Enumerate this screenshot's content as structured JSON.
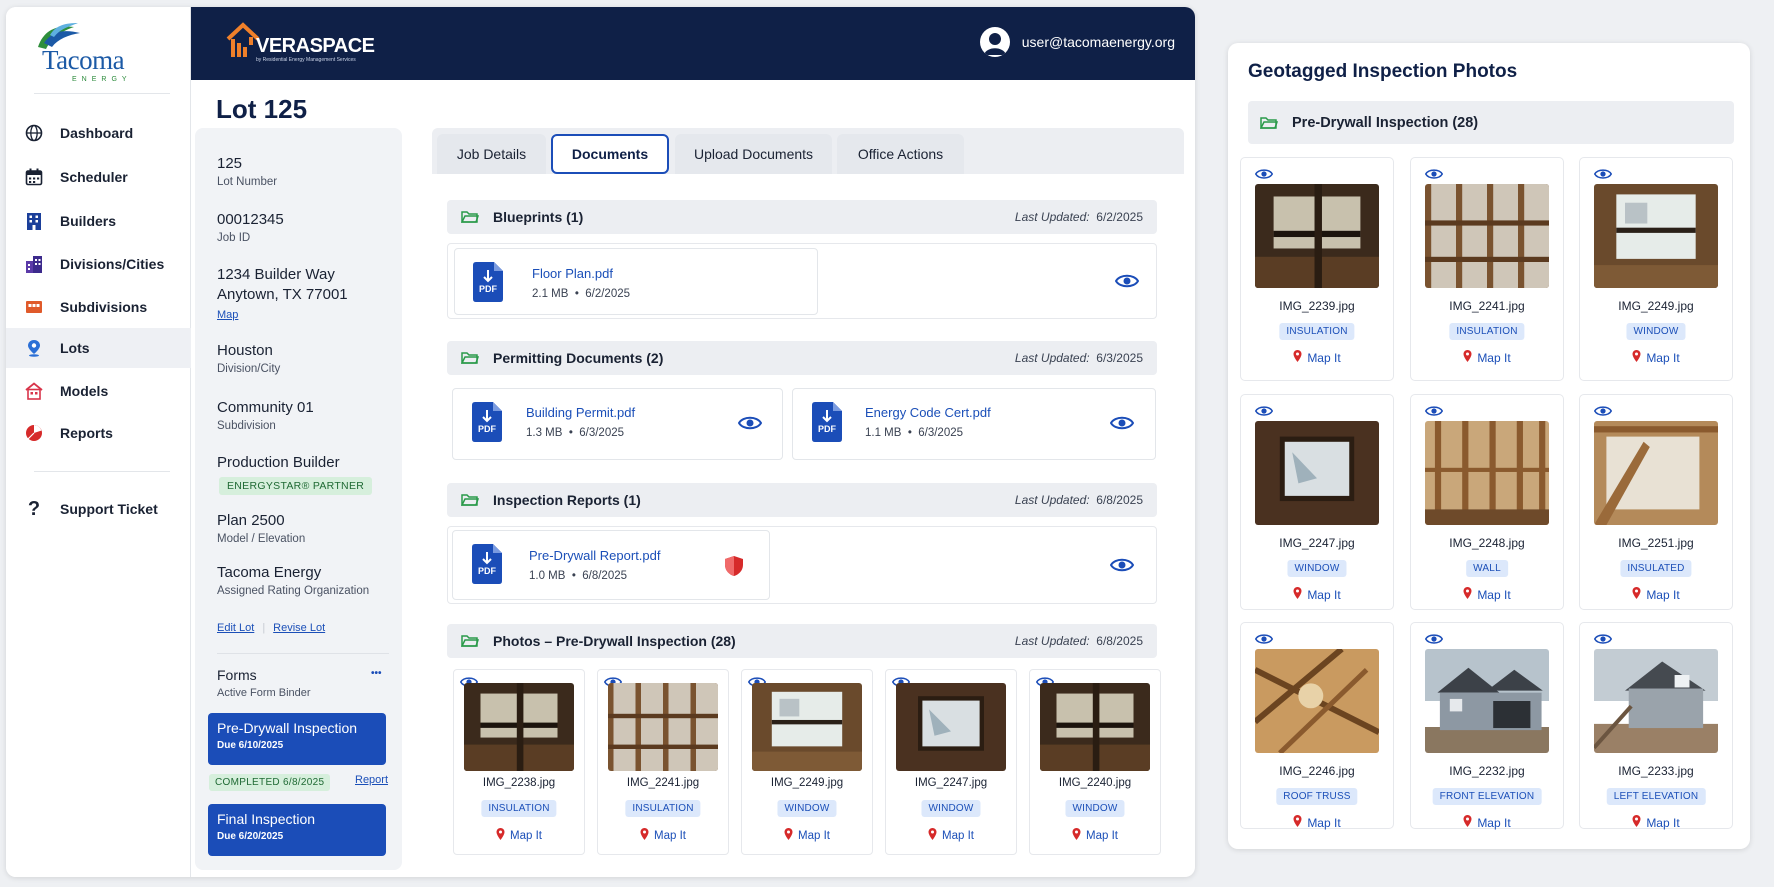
{
  "sidebar": {
    "logo_text": "Tacoma",
    "logo_sub": "ENERGY",
    "items": [
      {
        "label": "Dashboard",
        "icon": "globe-icon"
      },
      {
        "label": "Scheduler",
        "icon": "calendar-icon"
      },
      {
        "label": "Builders",
        "icon": "building-icon"
      },
      {
        "label": "Divisions/Cities",
        "icon": "city-icon"
      },
      {
        "label": "Subdivisions",
        "icon": "subdivision-icon"
      },
      {
        "label": "Lots",
        "icon": "pin-icon"
      },
      {
        "label": "Models",
        "icon": "house-icon"
      },
      {
        "label": "Reports",
        "icon": "pie-chart-icon"
      }
    ],
    "support": {
      "label": "Support Ticket",
      "icon": "question-icon"
    }
  },
  "header": {
    "brand": "VERASPACE",
    "brand_tag": "by Residential Energy Management Services",
    "user_email": "user@tacomaenergy.org"
  },
  "page": {
    "title": "Lot 125"
  },
  "lot_info": {
    "lot_number": {
      "value": "125",
      "label": "Lot Number"
    },
    "job_id": {
      "value": "00012345",
      "label": "Job ID"
    },
    "address": {
      "line1": "1234 Builder Way",
      "line2": "Anytown, TX 77001",
      "map_link": "Map"
    },
    "division": {
      "value": "Houston",
      "label": "Division/City"
    },
    "subdivision": {
      "value": "Community 01",
      "label": "Subdivision"
    },
    "builder": {
      "value": "Production Builder",
      "badge": "ENERGYSTAR® PARTNER"
    },
    "model": {
      "value": "Plan 2500",
      "label": "Model / Elevation"
    },
    "rating_org": {
      "value": "Tacoma Energy",
      "label": "Assigned Rating Organization"
    },
    "edit_link": "Edit Lot",
    "revise_link": "Revise Lot",
    "forms": {
      "title": "Forms",
      "subtitle": "Active Form Binder",
      "more": "•••",
      "items": [
        {
          "title": "Pre-Drywall Inspection",
          "due": "Due 6/10/2025",
          "status": "COMPLETED 6/8/2025",
          "report_link": "Report"
        },
        {
          "title": "Final Inspection",
          "due": "Due 6/20/2025"
        }
      ]
    }
  },
  "tabs": [
    {
      "label": "Job Details",
      "active": false
    },
    {
      "label": "Documents",
      "active": true
    },
    {
      "label": "Upload Documents",
      "active": false
    },
    {
      "label": "Office Actions",
      "active": false
    }
  ],
  "documents": {
    "updated_prefix": "Last Updated:",
    "pdf_label": "PDF",
    "sections": [
      {
        "title": "Blueprints (1)",
        "updated": "6/2/2025",
        "files": [
          {
            "name": "Floor Plan.pdf",
            "size": "2.1 MB",
            "date": "6/2/2025"
          }
        ]
      },
      {
        "title": "Permitting Documents (2)",
        "updated": "6/3/2025",
        "files": [
          {
            "name": "Building Permit.pdf",
            "size": "1.3 MB",
            "date": "6/3/2025"
          },
          {
            "name": "Energy Code Cert.pdf",
            "size": "1.1 MB",
            "date": "6/3/2025"
          }
        ]
      },
      {
        "title": "Inspection Reports (1)",
        "updated": "6/8/2025",
        "files": [
          {
            "name": "Pre-Drywall Report.pdf",
            "size": "1.0 MB",
            "date": "6/8/2025"
          }
        ]
      },
      {
        "title": "Photos – Pre-Drywall Inspection (28)",
        "updated": "6/8/2025"
      }
    ],
    "photos": [
      {
        "name": "IMG_2238.jpg",
        "tag": "INSULATION",
        "map": "Map It",
        "kind": "window-dark"
      },
      {
        "name": "IMG_2241.jpg",
        "tag": "INSULATION",
        "map": "Map It",
        "kind": "insulation"
      },
      {
        "name": "IMG_2249.jpg",
        "tag": "WINDOW",
        "map": "Map It",
        "kind": "window-light"
      },
      {
        "name": "IMG_2247.jpg",
        "tag": "WINDOW",
        "map": "Map It",
        "kind": "window-frame"
      },
      {
        "name": "IMG_2240.jpg",
        "tag": "WINDOW",
        "map": "Map It",
        "kind": "window-dark"
      }
    ]
  },
  "geotagged": {
    "title": "Geotagged Inspection Photos",
    "section": "Pre-Drywall Inspection (28)",
    "photos": [
      {
        "name": "IMG_2239.jpg",
        "tag": "INSULATION",
        "map": "Map It",
        "kind": "window-dark"
      },
      {
        "name": "IMG_2241.jpg",
        "tag": "INSULATION",
        "map": "Map It",
        "kind": "insulation"
      },
      {
        "name": "IMG_2249.jpg",
        "tag": "WINDOW",
        "map": "Map It",
        "kind": "window-light"
      },
      {
        "name": "IMG_2247.jpg",
        "tag": "WINDOW",
        "map": "Map It",
        "kind": "window-frame"
      },
      {
        "name": "IMG_2248.jpg",
        "tag": "WALL",
        "map": "Map It",
        "kind": "studs"
      },
      {
        "name": "IMG_2251.jpg",
        "tag": "INSULATED",
        "map": "Map It",
        "kind": "insulation-light"
      },
      {
        "name": "IMG_2246.jpg",
        "tag": "ROOF TRUSS",
        "map": "Map It",
        "kind": "truss"
      },
      {
        "name": "IMG_2232.jpg",
        "tag": "FRONT ELEVATION",
        "map": "Map It",
        "kind": "house"
      },
      {
        "name": "IMG_2233.jpg",
        "tag": "LEFT ELEVATION",
        "map": "Map It",
        "kind": "house-side"
      }
    ]
  },
  "colors": {
    "navy": "#0f2047",
    "accent": "#1b4db8",
    "link": "#1b4fb8",
    "green_badge": "#d6efdc",
    "tag_bg": "#dce8fb",
    "red": "#d62a2a"
  }
}
